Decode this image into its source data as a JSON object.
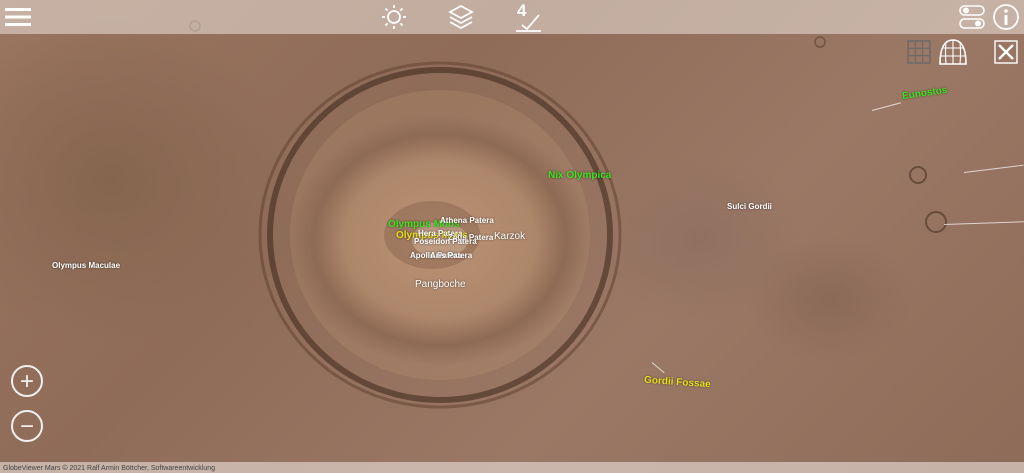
{
  "toolbar": {
    "layer_level": "4"
  },
  "labels": {
    "nix_olympica": "Nix Olympica",
    "eunostos": "Eunostos",
    "olympus_mons": "Olympus Mons",
    "olympus_mons_yellow": "Olympus Mons",
    "athena_patera": "Athena Patera",
    "hera_patera": "Hera Patera",
    "zeus_patera": "Zeus Patera",
    "poseidon_patera": "Poseidon Patera",
    "apollo_patera": "Apollo Patera",
    "aris_patera": "Aris Patera",
    "karzok": "Karzok",
    "pangboche": "Pangboche",
    "sulci_gordii": "Sulci Gordii",
    "olympus_maculae": "Olympus Maculae",
    "gordii_fossae": "Gordii Fossae"
  },
  "footer": {
    "copyright": "GlobeViewer Mars © 2021 Ralf Armin Böttcher, Softwareentwicklung"
  },
  "colors": {
    "feature_label": "#3de11f",
    "region_label": "#e8dd1b",
    "settlement_label": "#ffffff"
  }
}
